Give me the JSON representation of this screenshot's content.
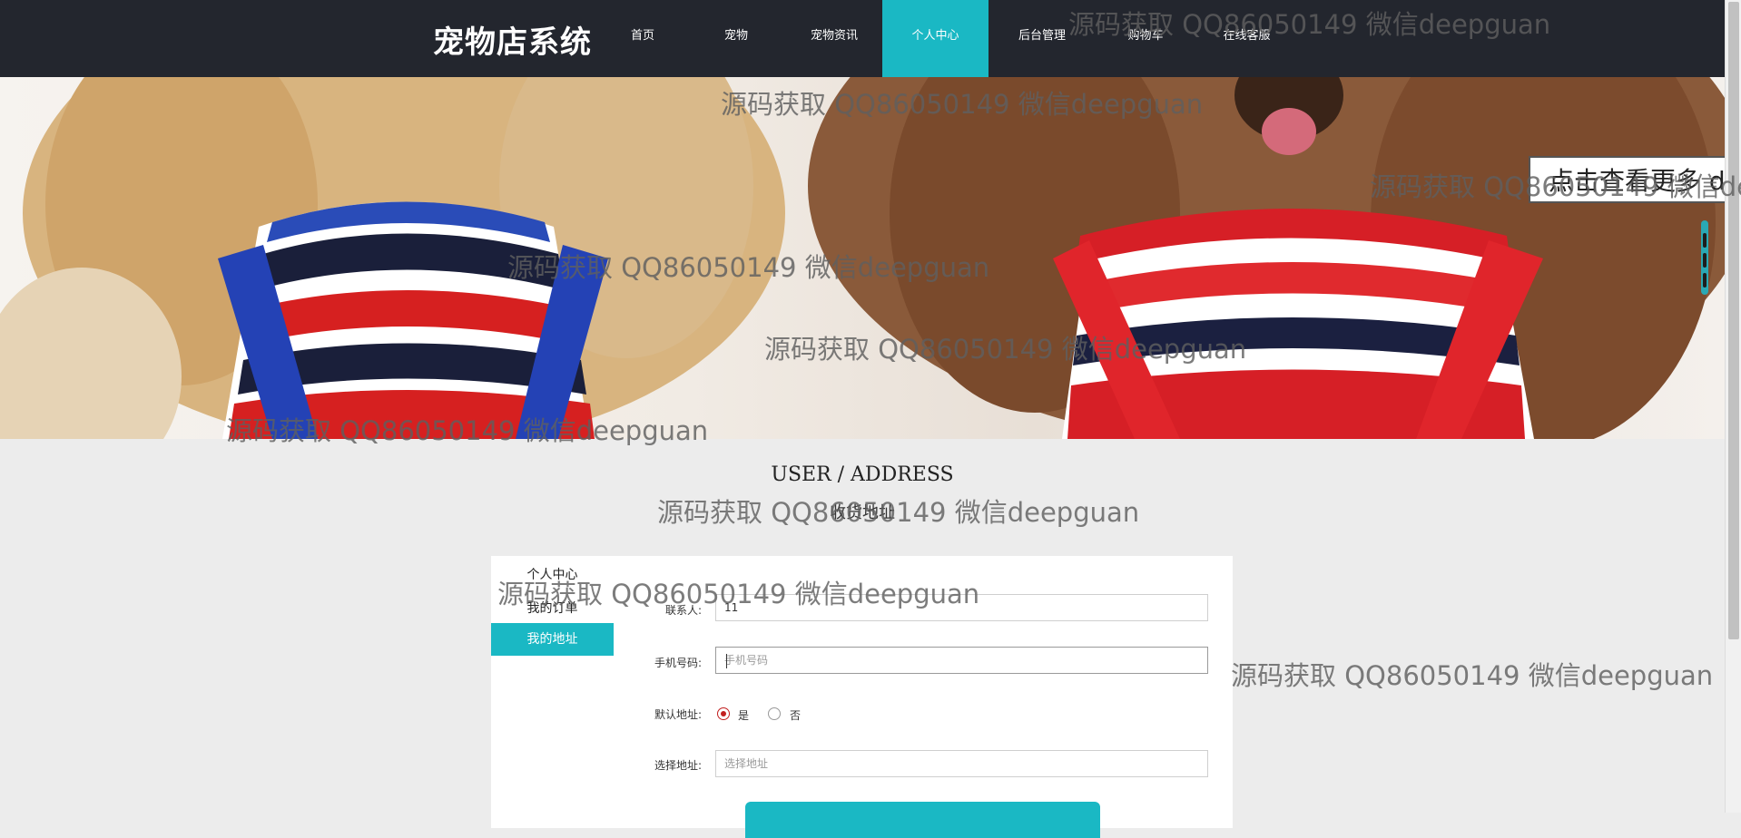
{
  "app": {
    "title": "宠物店系统"
  },
  "nav": {
    "items": [
      {
        "label": "首页"
      },
      {
        "label": "宠物"
      },
      {
        "label": "宠物资讯"
      },
      {
        "label": "个人中心",
        "active": true
      },
      {
        "label": "后台管理"
      },
      {
        "label": "购物车"
      },
      {
        "label": "在线客服"
      }
    ]
  },
  "hero": {
    "callout_text": "点击查看更多 d"
  },
  "section": {
    "title": "USER / ADDRESS",
    "subtitle": "收货地址"
  },
  "sidebar": {
    "items": [
      {
        "label": "个人中心"
      },
      {
        "label": "我的订单"
      },
      {
        "label": "我的地址",
        "active": true
      }
    ]
  },
  "form": {
    "contact": {
      "label": "联系人:",
      "value": "11"
    },
    "phone": {
      "label": "手机号码:",
      "value": "",
      "placeholder": "手机号码"
    },
    "default_address": {
      "label": "默认地址:",
      "options": [
        {
          "label": "是",
          "checked": true
        },
        {
          "label": "否",
          "checked": false
        }
      ]
    },
    "address": {
      "label": "选择地址:",
      "value": "",
      "placeholder": "选择地址"
    },
    "submit_label": ""
  },
  "watermark": {
    "text": "源码获取 QQ86050149 微信deepguan"
  },
  "colors": {
    "accent": "#1ab8c4",
    "nav_bg": "#23262e",
    "radio_checked": "#c21f1f"
  }
}
